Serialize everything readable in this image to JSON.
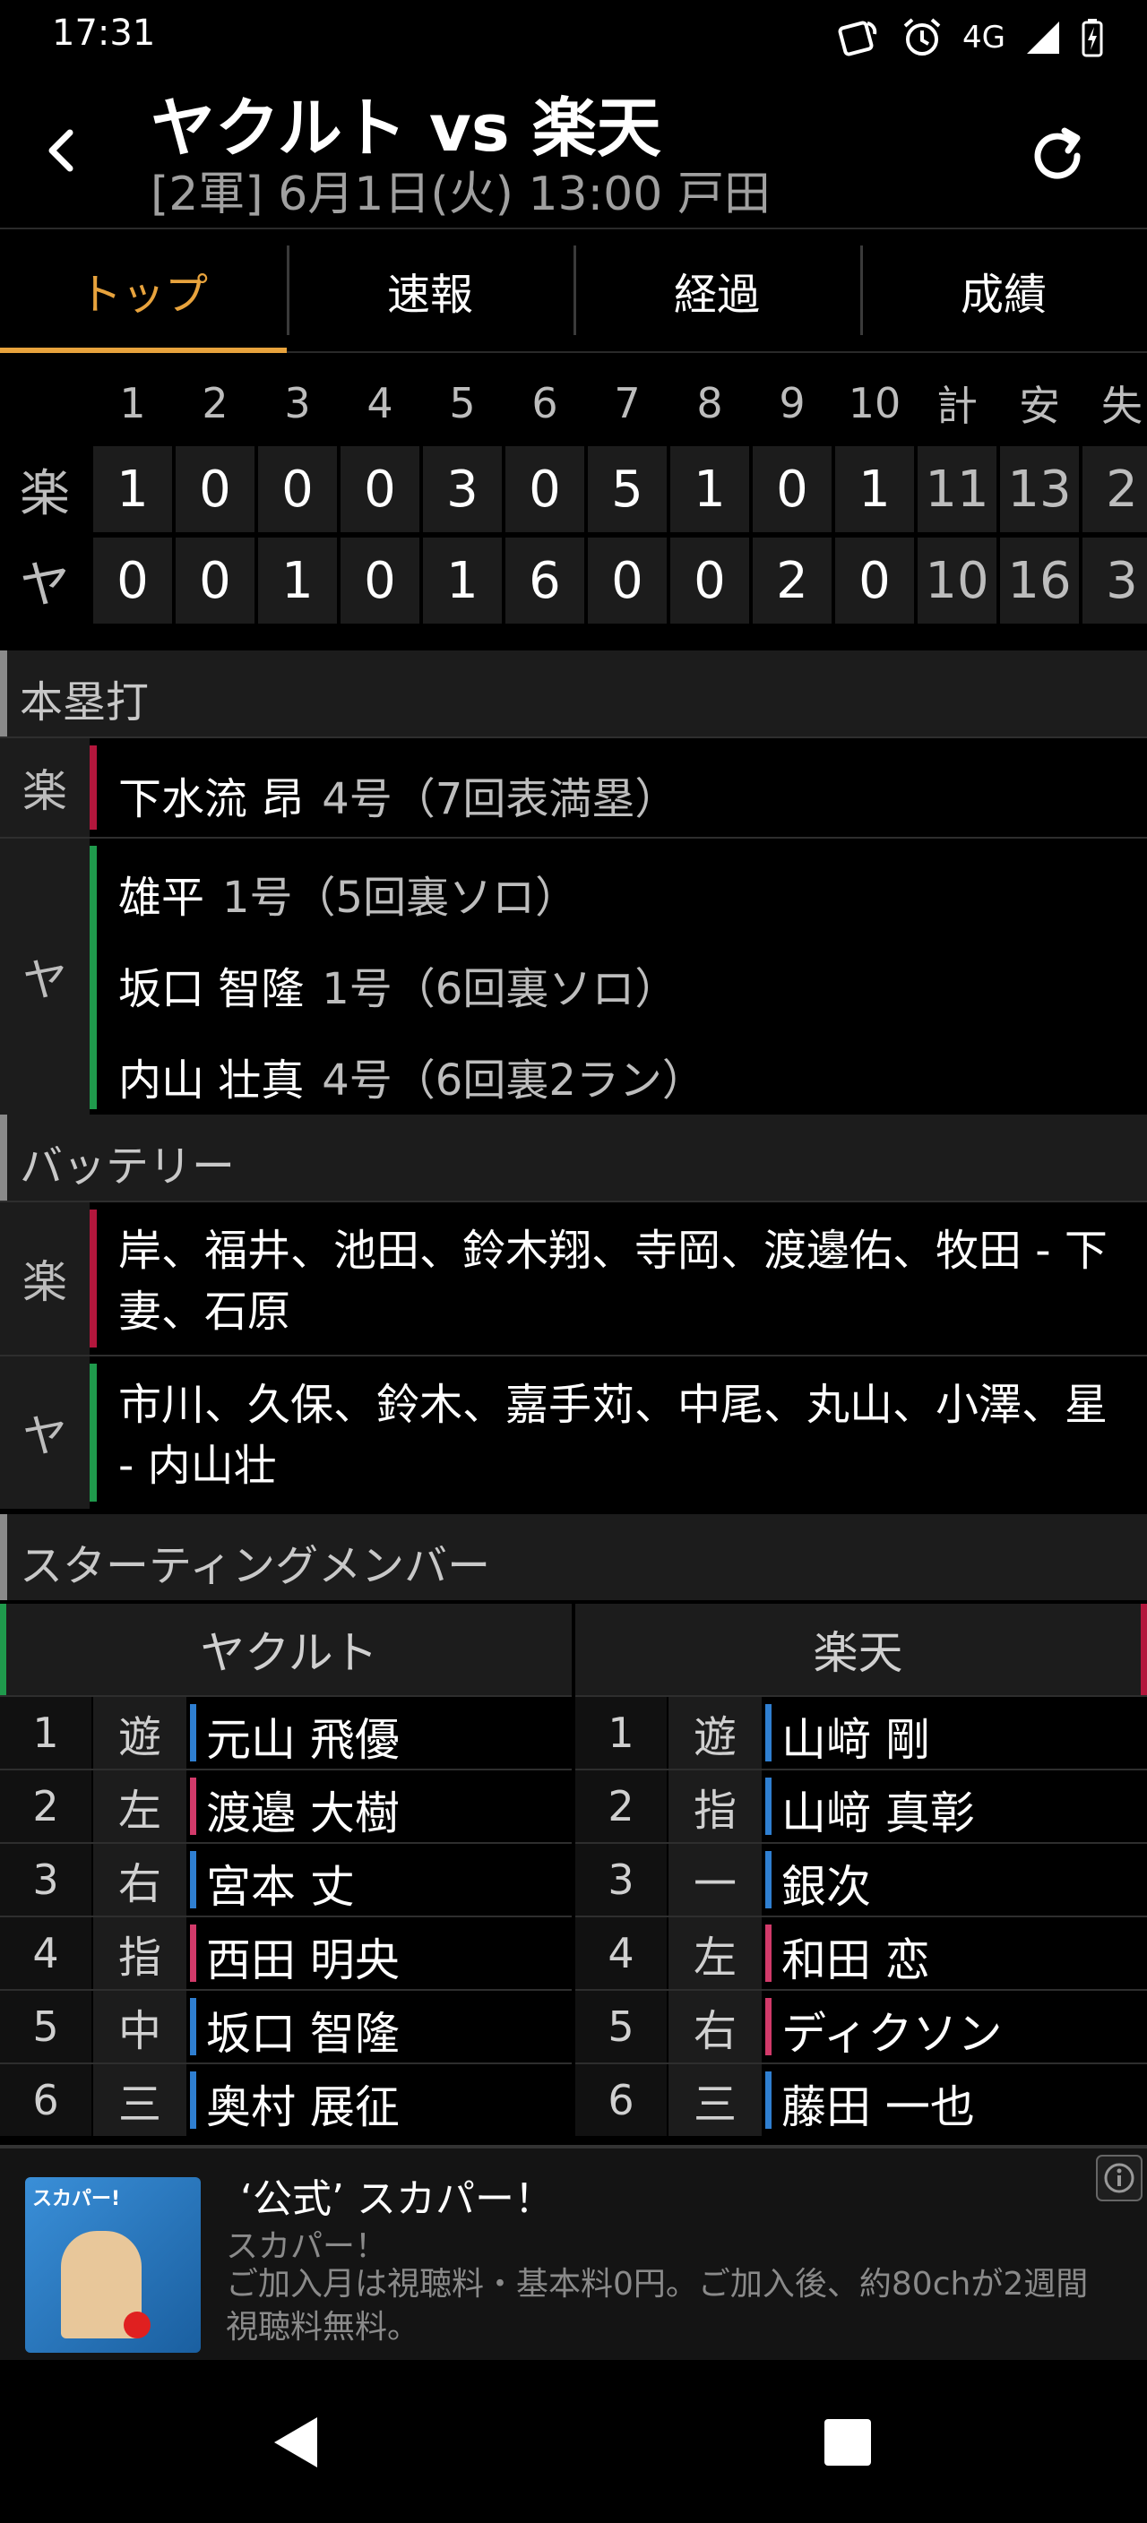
{
  "status_bar": {
    "time": "17:31",
    "network": "4G"
  },
  "header": {
    "title": "ヤクルト vs 楽天",
    "subtitle": "[2軍] 6月1日(火) 13:00 戸田"
  },
  "tabs": [
    {
      "label": "トップ",
      "active": true
    },
    {
      "label": "速報",
      "active": false
    },
    {
      "label": "経過",
      "active": false
    },
    {
      "label": "成績",
      "active": false
    }
  ],
  "scoreboard": {
    "columns": [
      "1",
      "2",
      "3",
      "4",
      "5",
      "6",
      "7",
      "8",
      "9",
      "10",
      "計",
      "安",
      "失"
    ],
    "rows": [
      {
        "team": "楽",
        "values": [
          "1",
          "0",
          "0",
          "0",
          "3",
          "0",
          "5",
          "1",
          "0",
          "1",
          "11",
          "13",
          "2"
        ]
      },
      {
        "team": "ヤ",
        "values": [
          "0",
          "0",
          "1",
          "0",
          "1",
          "6",
          "0",
          "0",
          "2",
          "0",
          "10",
          "16",
          "3"
        ]
      }
    ]
  },
  "homeruns": {
    "heading": "本塁打",
    "groups": [
      {
        "team": "楽",
        "color": "#b3163c",
        "entries": [
          {
            "player": "下水流 昂",
            "note": "4号（7回表満塁）"
          }
        ]
      },
      {
        "team": "ヤ",
        "color": "#1f9a4c",
        "entries": [
          {
            "player": "雄平",
            "note": "1号（5回裏ソロ）"
          },
          {
            "player": "坂口 智隆",
            "note": "1号（6回裏ソロ）"
          },
          {
            "player": "内山 壮真",
            "note": "4号（6回裏2ラン）"
          }
        ]
      }
    ]
  },
  "battery": {
    "heading": "バッテリー",
    "groups": [
      {
        "team": "楽",
        "color": "#b3163c",
        "text": "岸、福井、池田、鈴木翔、寺岡、渡邊佑、牧田 - 下妻、石原"
      },
      {
        "team": "ヤ",
        "color": "#1f9a4c",
        "text": "市川、久保、鈴木、嘉手苅、中尾、丸山、小澤、星 - 内山壮"
      }
    ]
  },
  "starting": {
    "heading": "スターティングメンバー",
    "left_team": "ヤクルト",
    "right_team": "楽天",
    "left_color": "#1f9a4c",
    "right_color": "#b3163c",
    "left": [
      {
        "num": "1",
        "pos": "遊",
        "name": "元山 飛優",
        "hand_color": "#2f7fd1"
      },
      {
        "num": "2",
        "pos": "左",
        "name": "渡邉 大樹",
        "hand_color": "#d23a6a"
      },
      {
        "num": "3",
        "pos": "右",
        "name": "宮本 丈",
        "hand_color": "#2f7fd1"
      },
      {
        "num": "4",
        "pos": "指",
        "name": "西田 明央",
        "hand_color": "#d23a6a"
      },
      {
        "num": "5",
        "pos": "中",
        "name": "坂口 智隆",
        "hand_color": "#2f7fd1"
      },
      {
        "num": "6",
        "pos": "三",
        "name": "奥村 展征",
        "hand_color": "#2f7fd1"
      }
    ],
    "right": [
      {
        "num": "1",
        "pos": "遊",
        "name": "山﨑 剛",
        "hand_color": "#2f7fd1"
      },
      {
        "num": "2",
        "pos": "指",
        "name": "山﨑 真彰",
        "hand_color": "#2f7fd1"
      },
      {
        "num": "3",
        "pos": "一",
        "name": "銀次",
        "hand_color": "#2f7fd1"
      },
      {
        "num": "4",
        "pos": "左",
        "name": "和田 恋",
        "hand_color": "#d23a6a"
      },
      {
        "num": "5",
        "pos": "右",
        "name": "ディクソン",
        "hand_color": "#d23a6a"
      },
      {
        "num": "6",
        "pos": "三",
        "name": "藤田 一也",
        "hand_color": "#2f7fd1"
      }
    ]
  },
  "ad": {
    "title": "‘公式’ スカパー！",
    "source": "スカパー！",
    "description": "ご加入月は視聴料・基本料0円。ご加入後、約80chが2週間視聴料無料。",
    "image_text": "スカパー!"
  },
  "colors": {
    "accent": "#e8a33d"
  }
}
